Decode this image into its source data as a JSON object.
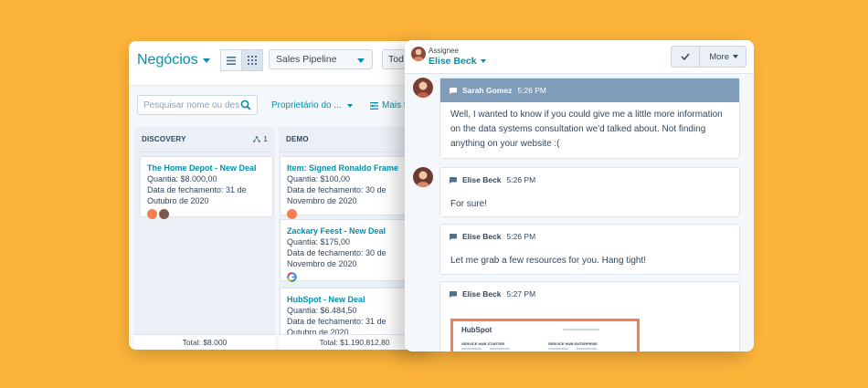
{
  "crm": {
    "title": "Negócios",
    "pipeline": "Sales Pipeline",
    "todo_label": "Tod",
    "search_placeholder": "Pesquisar nome ou des",
    "owner_filter": "Proprietário do ...",
    "more_filters": "Mais f",
    "columns": [
      {
        "name": "DISCOVERY",
        "count": "1",
        "total": "Total: $8.000",
        "cards": [
          {
            "title": "The Home Depot - New Deal",
            "amount": "Quantia: $8.000,00",
            "close_line1": "Data de fechamento: 31 de",
            "close_line2": "Outubro de 2020"
          }
        ]
      },
      {
        "name": "DEMO",
        "total": "Total: $1.190.812,80",
        "cards": [
          {
            "title": "Item: Signed Ronaldo Frame",
            "amount": "Quantia: $100,00",
            "close_line1": "Data de fechamento: 30 de",
            "close_line2": "Novembro de 2020"
          },
          {
            "title": "Zackary Feest - New Deal",
            "amount": "Quantia: $175,00",
            "close_line1": "Data de fechamento: 30 de",
            "close_line2": "Novembro de 2020"
          },
          {
            "title": "HubSpot - New Deal",
            "amount": "Quantia: $6.484,50",
            "close_line1": "Data de fechamento: 31 de",
            "close_line2": "Outubro de 2020"
          }
        ]
      }
    ]
  },
  "chat": {
    "assignee_label": "Assignee",
    "assignee_name": "Elise Beck",
    "more_label": "More",
    "messages": [
      {
        "author": "Sarah Gomez",
        "time": "5:26 PM",
        "text": "Well, I wanted to know if you could give me a little more information on the data systems consultation we'd talked about. Not finding anything on your website :("
      },
      {
        "author": "Elise Beck",
        "time": "5:26 PM",
        "text": "For sure!"
      },
      {
        "author": "Elise Beck",
        "time": "5:26 PM",
        "text": "Let me grab a few resources for you. Hang tight!"
      },
      {
        "author": "Elise Beck",
        "time": "5:27 PM",
        "text": ""
      }
    ],
    "attachment": {
      "logo": "HubSpot",
      "col1": "SERVICE HUB STARTER",
      "col2": "SERVICE HUB ENTERPRISE"
    }
  },
  "colors": {
    "background": "#fcb43a",
    "accent": "#0091ae",
    "customer_header": "#7f9db9",
    "hubspot_orange": "#f47d52"
  }
}
